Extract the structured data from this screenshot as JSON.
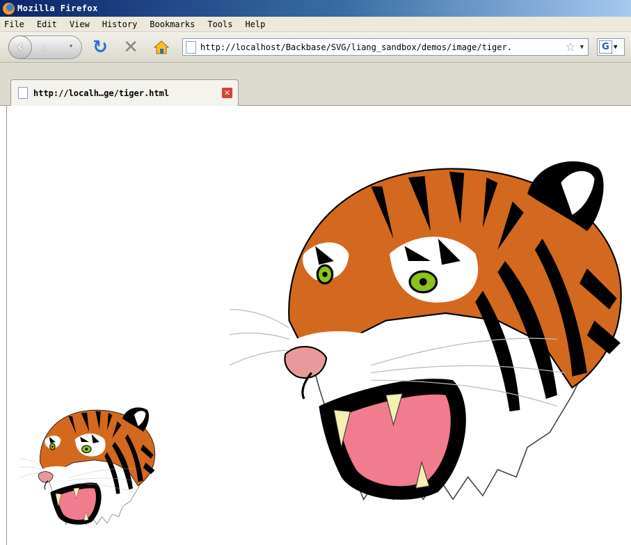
{
  "window": {
    "title": "Mozilla Firefox"
  },
  "menu": {
    "items": [
      "File",
      "Edit",
      "View",
      "History",
      "Bookmarks",
      "Tools",
      "Help"
    ]
  },
  "nav": {
    "url": "http://localhost/Backbase/SVG/liang_sandbox/demos/image/tiger.",
    "search_engine_label": "G",
    "icons": [
      "back-icon",
      "forward-icon",
      "reload-icon",
      "stop-icon",
      "home-icon",
      "bookmark-star-icon"
    ]
  },
  "tabs": [
    {
      "title": "http://localh…ge/tiger.html"
    }
  ],
  "colors": {
    "tiger_orange": "#d2691e",
    "tiger_black": "#000000",
    "eye_green": "#8bc21d",
    "mouth_pink": "#f07c8d",
    "title_blue": "#0a246a"
  }
}
